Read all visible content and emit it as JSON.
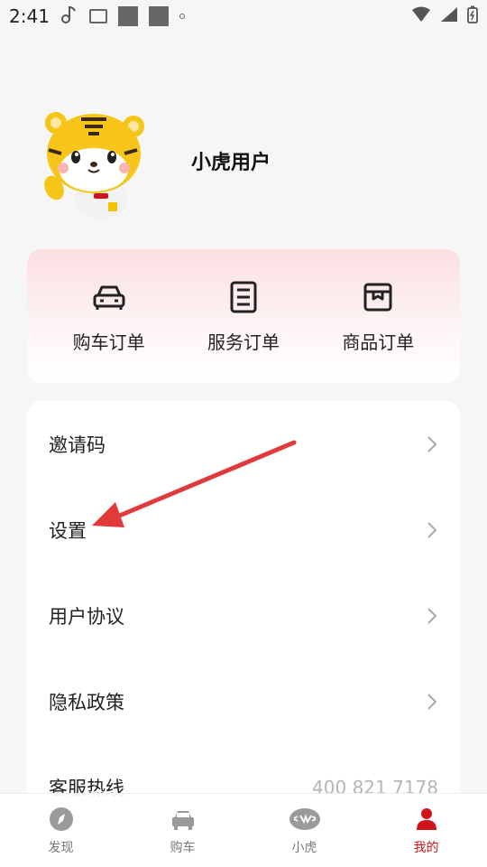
{
  "status_bar": {
    "time": "2:41"
  },
  "profile": {
    "username": "小虎用户"
  },
  "orders": [
    {
      "label": "购车订单",
      "icon": "car-icon"
    },
    {
      "label": "服务订单",
      "icon": "clipboard-icon"
    },
    {
      "label": "商品订单",
      "icon": "shopping-bag-icon"
    }
  ],
  "menu": {
    "invite_code": "邀请码",
    "settings": "设置",
    "user_agreement": "用户协议",
    "privacy_policy": "隐私政策",
    "hotline_label": "客服热线",
    "hotline_number": "400 821 7178"
  },
  "tabs": [
    {
      "label": "发现",
      "icon": "compass-icon"
    },
    {
      "label": "购车",
      "icon": "car-icon"
    },
    {
      "label": "小虎",
      "icon": "tiger-logo-icon"
    },
    {
      "label": "我的",
      "icon": "person-icon"
    }
  ],
  "colors": {
    "accent": "#d0121b",
    "annotation_arrow": "#e03a3a"
  }
}
